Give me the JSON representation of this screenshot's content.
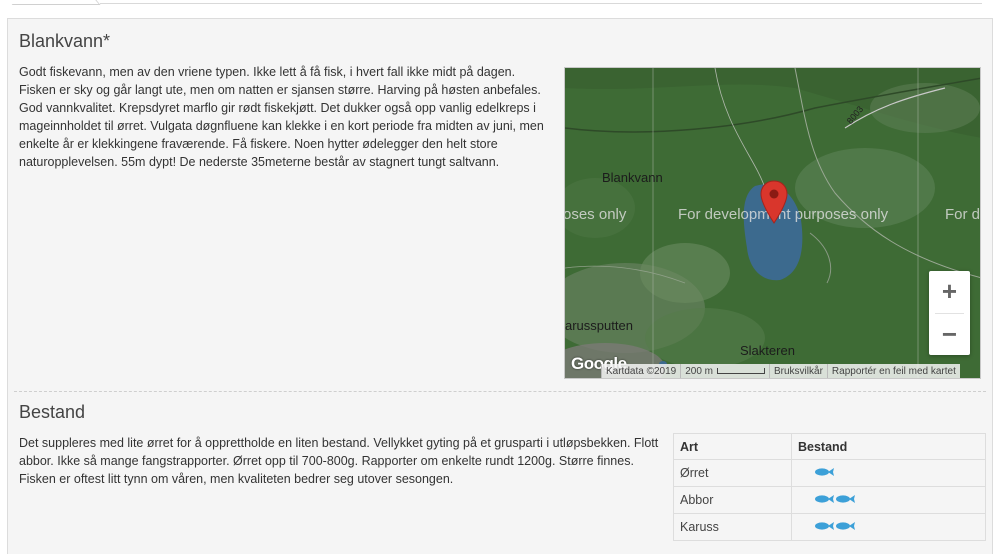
{
  "lake": {
    "title": "Blankvann*",
    "description": "Godt fiskevann, men av den vriene typen. Ikke lett å få fisk, i hvert fall ikke midt på dagen. Fisken er sky og går langt ute, men om natten er sjansen større. Harving på høsten anbefales. God vannkvalitet. Krepsdyret marflo gir rødt fiskekjøtt. Det dukker også opp vanlig edelkreps i mageinnholdet til ørret. Vulgata døgnfluene kan klekke i en kort periode fra midten av juni, men enkelte år er klekkingene fraværende. Få fiskere. Noen hytter ødelegger den helt store naturopplevelsen. 55m dypt! De nederste 35meterne består av stagnert tungt saltvann."
  },
  "map": {
    "watermark_left": "oses only",
    "watermark_center": "For development purposes only",
    "watermark_right": "For d",
    "place_blankvann": "Blankvann",
    "place_karussputten": "arussputten",
    "place_slakteren": "Slakteren",
    "road_label": "8003",
    "zoom_in": "+",
    "zoom_out": "−",
    "logo": "Google",
    "footer": {
      "copyright": "Kartdata ©2019",
      "scale": "200 m",
      "terms": "Bruksvilkår",
      "report": "Rapportér en feil med kartet"
    },
    "colors": {
      "forest": "#3e6b35",
      "water": "#3c6a8e",
      "marker": "#d9362c"
    }
  },
  "stock": {
    "title": "Bestand",
    "description": "Det suppleres med lite ørret for å opprettholde en liten bestand. Vellykket gyting på et grusparti i utløpsbekken. Flott abbor. Ikke så mange fangstrapporter. Ørret opp til 700-800g. Rapporter om enkelte rundt 1200g. Større finnes. Fisken er oftest litt tynn om våren, men kvaliteten bedrer seg utover sesongen.",
    "table": {
      "headers": [
        "Art",
        "Bestand"
      ],
      "rows": [
        {
          "species": "Ørret",
          "level": 1
        },
        {
          "species": "Abbor",
          "level": 2
        },
        {
          "species": "Karuss",
          "level": 2
        }
      ],
      "fish_icon_color": "#3ca0d8"
    }
  }
}
